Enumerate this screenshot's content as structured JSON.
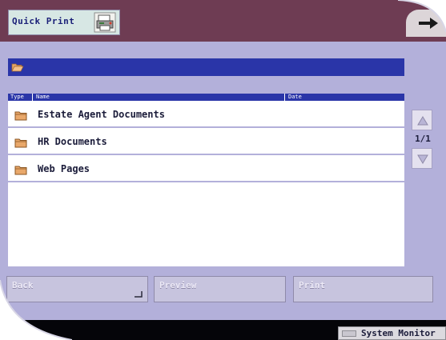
{
  "header": {
    "title": "Quick Print",
    "printer_icon": "printer-icon",
    "exit_icon": "exit-arrow-icon"
  },
  "path_bar": {
    "icon": "folder-open-icon"
  },
  "list": {
    "columns": {
      "type": "Type",
      "name": "Name",
      "date": "Date"
    },
    "rows": [
      {
        "name": "Estate Agent Documents",
        "icon": "folder-icon"
      },
      {
        "name": "HR Documents",
        "icon": "folder-icon"
      },
      {
        "name": "Web Pages",
        "icon": "folder-icon"
      }
    ]
  },
  "pager": {
    "page": "1/1",
    "up_icon": "arrow-up-icon",
    "down_icon": "arrow-down-icon"
  },
  "buttons": {
    "back": "Back",
    "preview": "Preview",
    "print": "Print"
  },
  "status": {
    "system_monitor": "System Monitor"
  },
  "colors": {
    "panel": "#b3b0da",
    "header_bar": "#6e3c53",
    "accent_blue": "#2a35a8",
    "folder": "#e9a86a"
  }
}
